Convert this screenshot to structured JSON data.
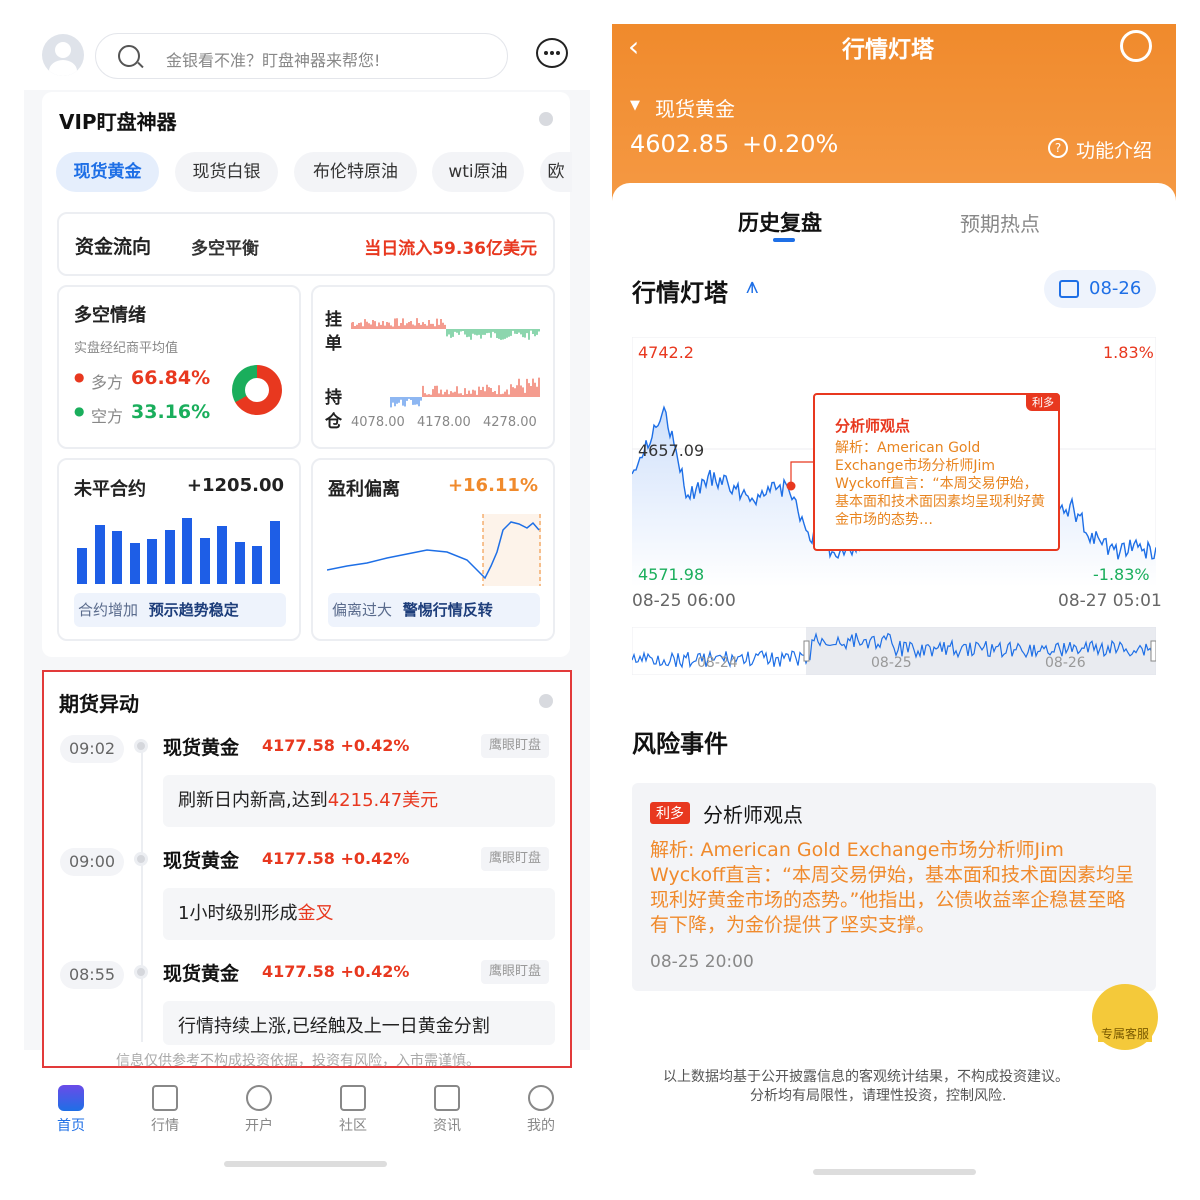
{
  "left": {
    "search_placeholder": "金银看不准？盯盘神器来帮您!",
    "vip_title": "VIP盯盘神器",
    "chips": [
      "现货黄金",
      "现货白银",
      "布伦特原油",
      "wti原油",
      "欧"
    ],
    "fund_flow": {
      "label": "资金流向",
      "status": "多空平衡",
      "value": "当日流入59.36亿美元"
    },
    "sentiment": {
      "title": "多空情绪",
      "subtitle": "实盘经纪商平均值",
      "long_label": "多方",
      "long_value": "66.84%",
      "short_label": "空方",
      "short_value": "33.16%",
      "long_fraction": 0.6684
    },
    "orderbook": {
      "label1": "挂",
      "label1b": "单",
      "label2": "持",
      "label2b": "仓",
      "ticks": [
        "4078.00",
        "4178.00",
        "4278.00"
      ]
    },
    "open_interest": {
      "title": "未平合约",
      "value": "+1205.00",
      "tag_a": "合约增加",
      "tag_b": "预示趋势稳定"
    },
    "profit_dev": {
      "title": "盈利偏离",
      "value": "+16.11%",
      "tag_a": "偏离过大",
      "tag_b": "警惕行情反转"
    },
    "futures": {
      "title": "期货异动",
      "items": [
        {
          "time": "09:02",
          "name": "现货黄金",
          "price": "4177.58 +0.42%",
          "badge": "鹰眼盯盘",
          "body_pre": "刷新日内新高,达到",
          "body_hl": "4215.47美元"
        },
        {
          "time": "09:00",
          "name": "现货黄金",
          "price": "4177.58 +0.42%",
          "badge": "鹰眼盯盘",
          "body_pre": "1小时级别形成",
          "body_hl": "金叉"
        },
        {
          "time": "08:55",
          "name": "现货黄金",
          "price": "4177.58 +0.42%",
          "badge": "鹰眼盯盘",
          "body_pre": "行情持续上涨,已经触及上一日黄金分割",
          "body_hl": ""
        }
      ]
    },
    "disclaimer": "信息仅供参考不构成投资依据，投资有风险，入市需谨慎。",
    "nav": [
      "首页",
      "行情",
      "开户",
      "社区",
      "资讯",
      "我的"
    ]
  },
  "right": {
    "header_title": "行情灯塔",
    "instrument": "现货黄金",
    "price": "4602.85",
    "change": "+0.20%",
    "func_intro": "功能介绍",
    "tabs": [
      "历史复盘",
      "预期热点"
    ],
    "section_title": "行情灯塔",
    "date_chip": "08-26",
    "chart": {
      "y_top": "4742.2",
      "y_top_pct": "1.83%",
      "y_mid": "4657.09",
      "y_bot": "4571.98",
      "y_bot_pct": "-1.83%",
      "x_start": "08-25 06:00",
      "x_end": "08-27 05:01",
      "mini_labels": [
        "08-24",
        "08-25",
        "08-26"
      ]
    },
    "popup": {
      "tag": "利多",
      "title": "分析师观点",
      "text": "解析：American Gold Exchange市场分析师Jim Wyckoff直言：“本周交易伊始，基本面和技术面因素均呈现利好黄金市场的态势…"
    },
    "risk_title": "风险事件",
    "risk_card": {
      "tag": "利多",
      "title": "分析师观点",
      "text": "解析: American Gold Exchange市场分析师Jim Wyckoff直言：“本周交易伊始，基本面和技术面因素均呈现利好黄金市场的态势。”他指出，公债收益率企稳甚至略有下降，为金价提供了坚实支撑。",
      "time": "08-25 20:00"
    },
    "service_label": "专属客服",
    "footer1": "以上数据均基于公开披露信息的客观统计结果，不构成投资建议。",
    "footer2": "分析均有局限性，请理性投资，控制风险."
  },
  "colors": {
    "accent": "#1e6fe6",
    "up": "#e8381f",
    "down": "#1aae5c",
    "orange": "#f08a2c"
  }
}
